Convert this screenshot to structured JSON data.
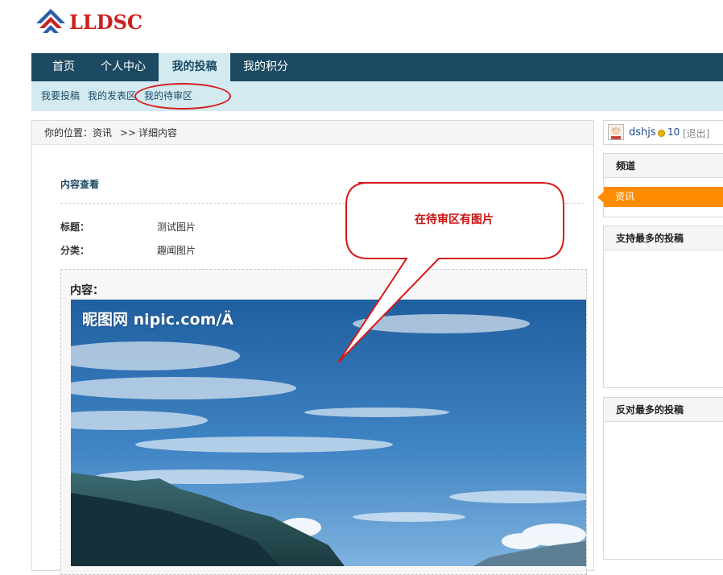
{
  "logo": {
    "text": "LLDSC"
  },
  "main_nav": {
    "items": [
      "首页",
      "个人中心",
      "我的投稿",
      "我的积分"
    ],
    "active": "我的投稿"
  },
  "sub_nav": {
    "items": [
      "我要投稿",
      "我的发表区",
      "我的待审区"
    ]
  },
  "breadcrumb": {
    "prefix": "你的位置：",
    "section": "资讯",
    "sep": ">>",
    "current": "详细内容"
  },
  "detail": {
    "section_title": "内容查看",
    "fields": [
      {
        "label": "标题：",
        "value": "测试图片"
      },
      {
        "label": "分类：",
        "value": "趣闻图片"
      }
    ],
    "content_label": "内容：",
    "image_watermark": "昵图网 nipic.com/Ä"
  },
  "callout": {
    "text": "在待审区有图片"
  },
  "user": {
    "name": "dshjs",
    "score": "10",
    "logout": "[退出]"
  },
  "sidebar": {
    "channel_title": "频道",
    "channel_item": "资讯",
    "most_supported_title": "支持最多的投稿",
    "most_opposed_title": "反对最多的投稿"
  },
  "colors": {
    "nav": "#1d4a63",
    "subnav": "#d3eaf1",
    "accent": "#ff8c00",
    "logo": "#cc1f1f",
    "annotation": "#d61a1a"
  }
}
